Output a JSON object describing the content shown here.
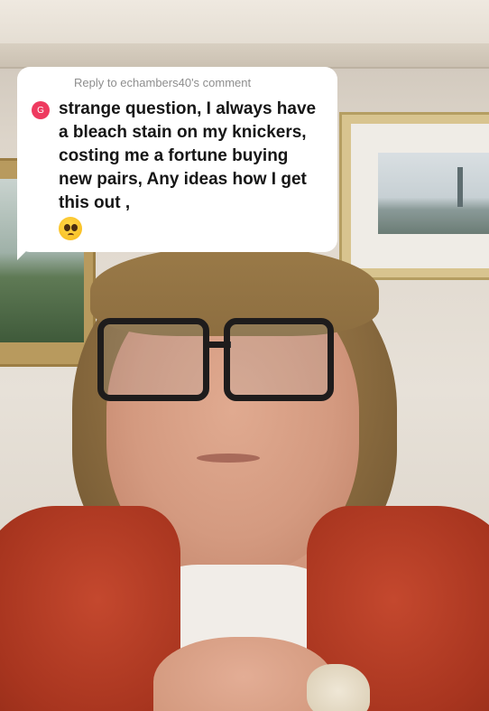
{
  "reply": {
    "header": "Reply to echambers40's comment",
    "avatar_letter": "G",
    "avatar_color": "#ee3a5f",
    "comment": "strange question, I always have a bleach stain on my knickers, costing me a fortune buying new pairs, Any ideas how I get this out ,",
    "emoji_icon": "pleading-face-emoji"
  }
}
